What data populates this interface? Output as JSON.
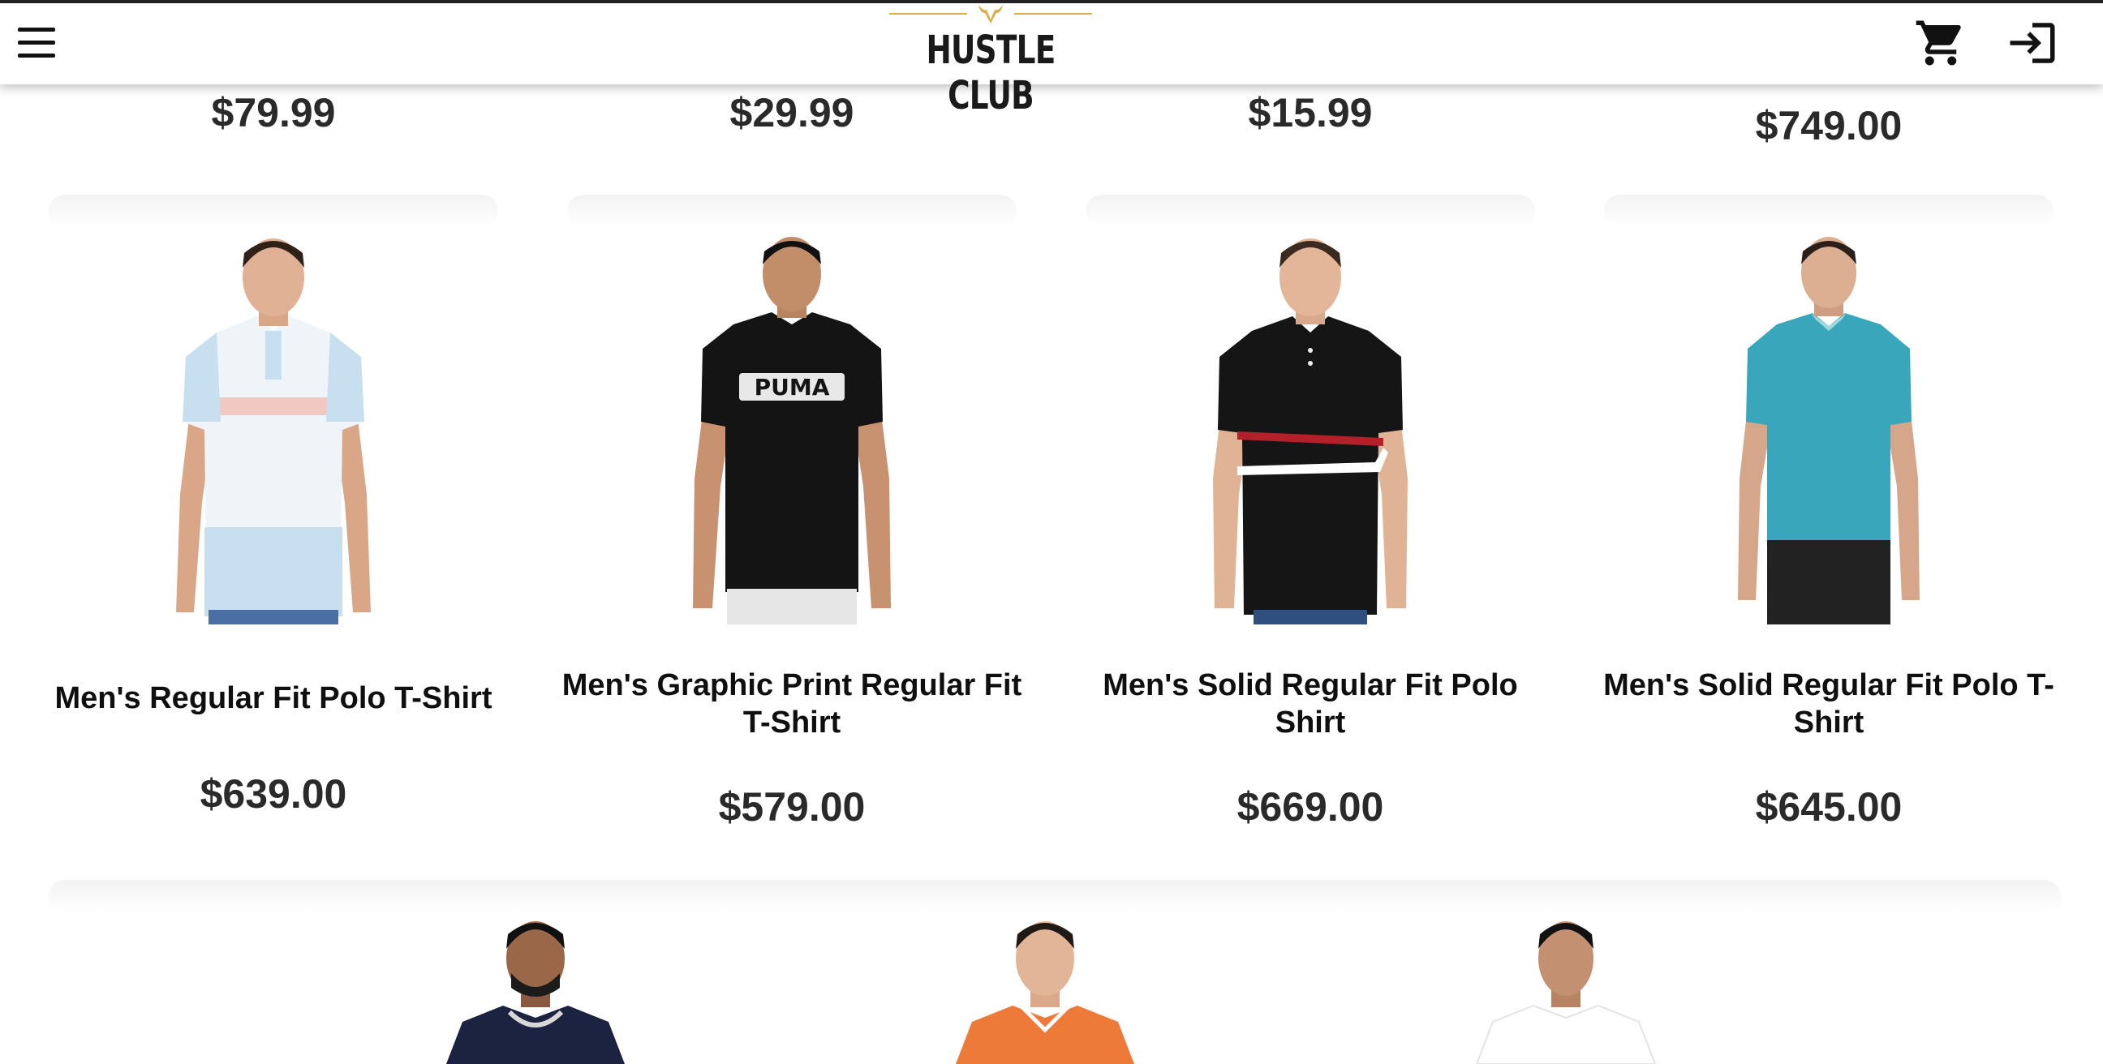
{
  "header": {
    "brand": "HUSTLE CLUB",
    "menu_icon": "hamburger-menu-icon",
    "cart_icon": "shopping-cart-icon",
    "login_icon": "login-arrow-icon",
    "accent_color": "#d9b04a"
  },
  "top_row": [
    {
      "price": "$79.99"
    },
    {
      "price": "$29.99"
    },
    {
      "price": "$15.99"
    },
    {
      "price": "$749.00"
    }
  ],
  "products": [
    {
      "title": "Men's Regular Fit Polo T-Shirt",
      "price": "$639.00",
      "shirt_color": "#cfe3f0"
    },
    {
      "title": "Men's Graphic Print Regular Fit T-Shirt",
      "price": "$579.00",
      "shirt_color": "#141414",
      "print": "PUMA"
    },
    {
      "title": "Men's Solid Regular Fit Polo Shirt",
      "price": "$669.00",
      "shirt_color": "#151515"
    },
    {
      "title": "Men's Solid Regular Fit Polo T-Shirt",
      "price": "$645.00",
      "shirt_color": "#3aa6bb"
    }
  ],
  "next_row": [
    {
      "shirt_color": "#1c2340"
    },
    {
      "shirt_color": "#ee7a3a"
    },
    {
      "shirt_color": "#ffffff"
    }
  ]
}
